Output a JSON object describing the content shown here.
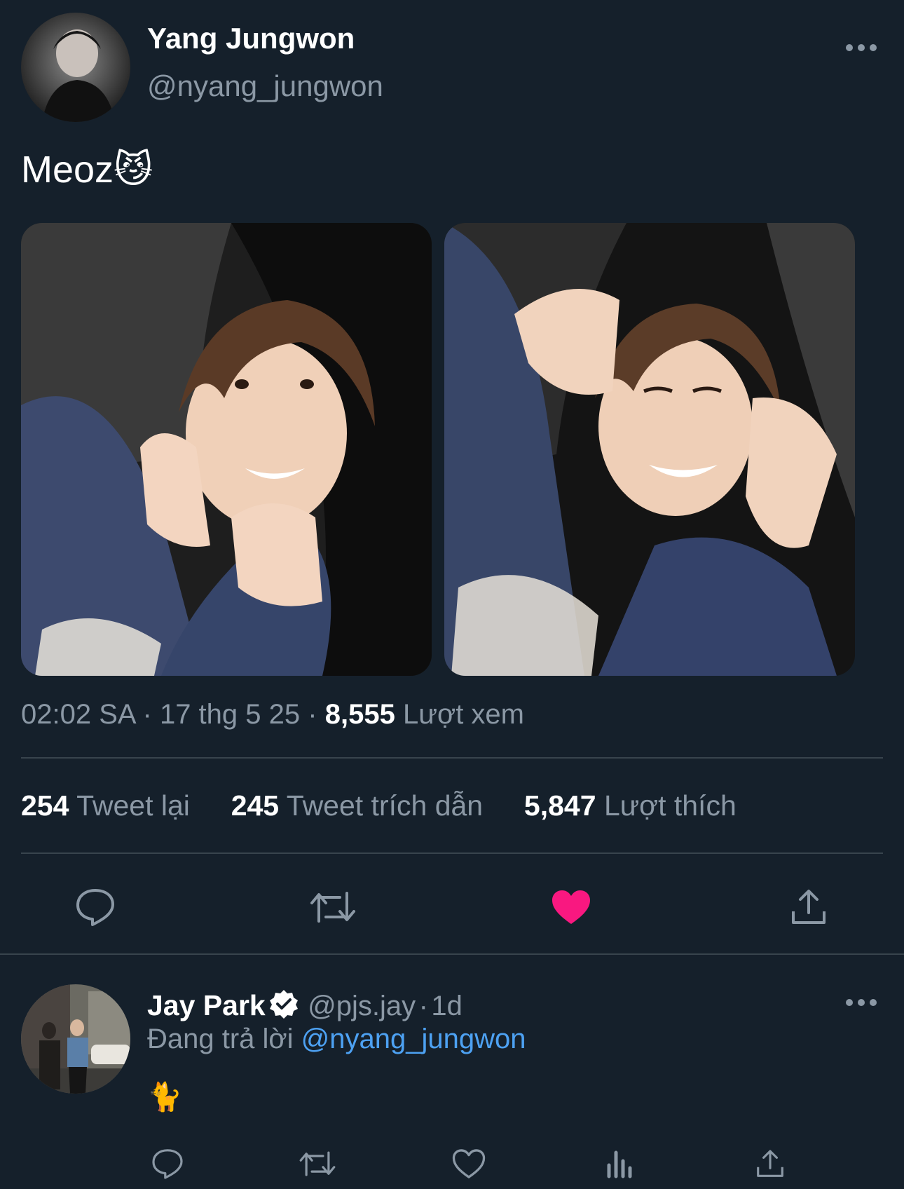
{
  "tweet": {
    "author_name": "Yang Jungwon",
    "author_handle": "@nyang_jungwon",
    "text": "Meoz",
    "emoji": "😼",
    "time": "02:02 SA",
    "date": "17 thg 5 25",
    "separator": "·",
    "views_count": "8,555",
    "views_label": "Lượt xem",
    "more_icon": "more-horizontal-icon"
  },
  "stats": {
    "retweets_count": "254",
    "retweets_label": "Tweet lại",
    "quotes_count": "245",
    "quotes_label": "Tweet trích dẫn",
    "likes_count": "5,847",
    "likes_label": "Lượt thích"
  },
  "actions": {
    "reply_icon": "reply-icon",
    "retweet_icon": "retweet-icon",
    "like_icon": "heart-filled-icon",
    "share_icon": "share-icon",
    "like_color": "#f91880"
  },
  "reply": {
    "author_name": "Jay Park",
    "verified_icon": "verified-badge-icon",
    "author_handle": "@pjs.jay",
    "separator": "·",
    "time": "1d",
    "replying_prefix": "Đang trả lời",
    "replying_to": "@nyang_jungwon",
    "text": "🐈"
  },
  "colors": {
    "background": "#15202b",
    "secondary_text": "#8b98a5",
    "divider": "#38444d",
    "link": "#4da1f2"
  }
}
